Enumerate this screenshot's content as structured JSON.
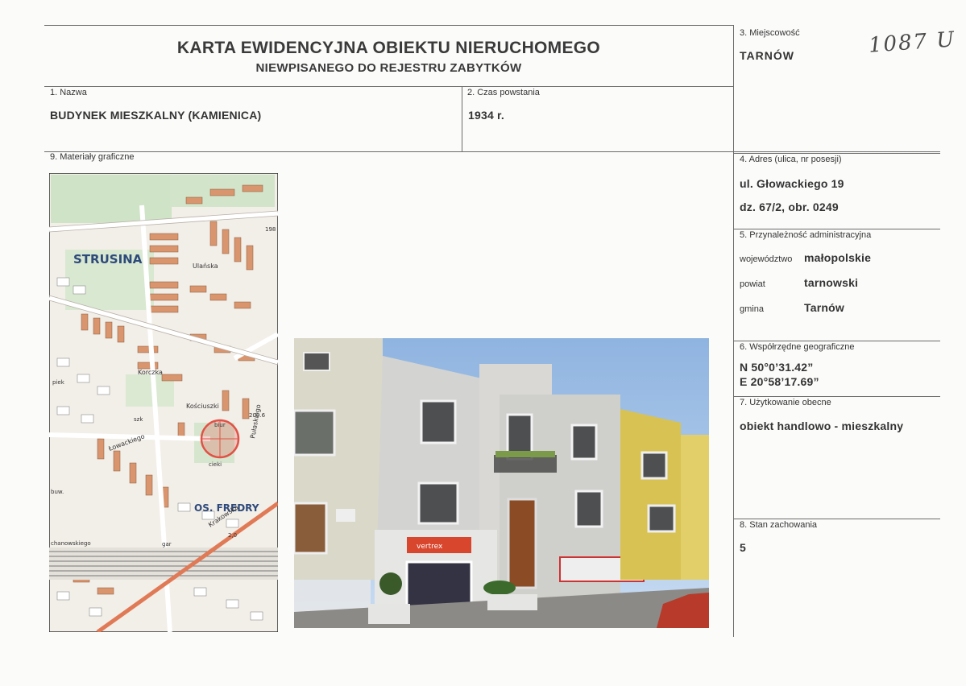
{
  "header": {
    "title": "KARTA EWIDENCYJNA OBIEKTU NIERUCHOMEGO",
    "subtitle": "NIEWPISANEGO DO REJESTRU ZABYTKÓW",
    "handwritten_number": "1087 U"
  },
  "fields": {
    "nazwa": {
      "label": "1. Nazwa",
      "value": "BUDYNEK MIESZKALNY (KAMIENICA)"
    },
    "czas": {
      "label": "2. Czas powstania",
      "value": "1934 r."
    },
    "miejscowosc": {
      "label": "3. Miejscowość",
      "value": "TARNÓW"
    },
    "adres": {
      "label": "4. Adres (ulica, nr posesji)",
      "line1": "ul. Głowackiego 19",
      "line2": "dz. 67/2, obr. 0249"
    },
    "przynaleznosc": {
      "label": "5. Przynależność administracyjna",
      "rows": [
        {
          "key": "województwo",
          "value": "małopolskie"
        },
        {
          "key": "powiat",
          "value": "tarnowski"
        },
        {
          "key": "gmina",
          "value": "Tarnów"
        }
      ]
    },
    "wspolrzedne": {
      "label": "6. Współrzędne geograficzne",
      "n": "N 50°0’31.42”",
      "e": "E 20°58’17.69”"
    },
    "uzytkowanie": {
      "label": "7. Użytkowanie obecne",
      "value": "obiekt handlowo - mieszkalny"
    },
    "stan": {
      "label": "8. Stan zachowania",
      "value": "5"
    },
    "materialy": {
      "label": "9. Materiały graficzne"
    }
  },
  "map": {
    "labels": [
      "STRUSINA",
      "OS. FREDRY",
      "Ulańska",
      "Kościuszki",
      "Krakowska",
      "Pułaskiego",
      "Korczka",
      "Łowackiego",
      "biur",
      "szk",
      "cieki",
      "piek",
      "buw.",
      "chanowskiego",
      "gar",
      "200.6",
      "198",
      "2,0"
    ]
  },
  "photo": {
    "sign": "vertrex"
  }
}
